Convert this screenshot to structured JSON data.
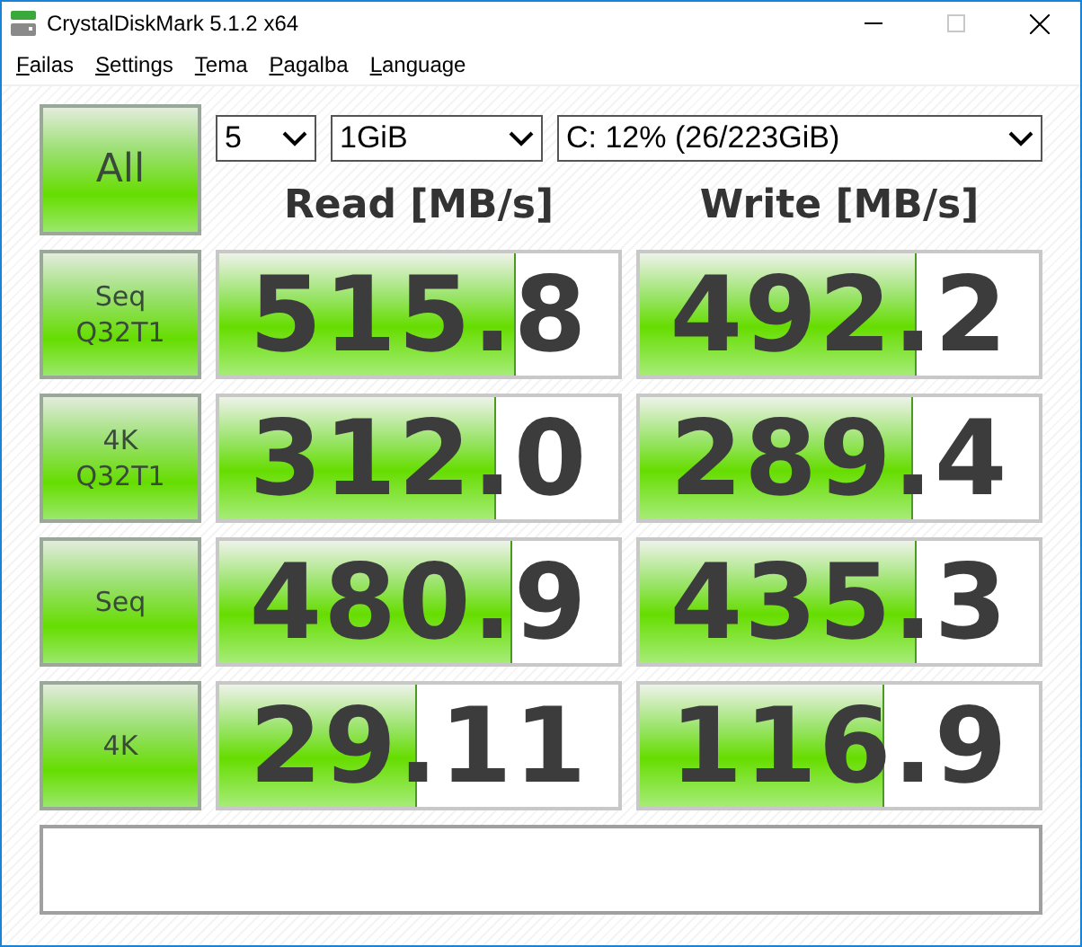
{
  "window": {
    "title": "CrystalDiskMark 5.1.2 x64",
    "maximize_disabled": true
  },
  "menu": [
    {
      "label": "Failas"
    },
    {
      "label": "Settings"
    },
    {
      "label": "Tema"
    },
    {
      "label": "Pagalba"
    },
    {
      "label": "Language"
    }
  ],
  "all_button": "All",
  "selects": [
    {
      "kind": "count",
      "value": "5"
    },
    {
      "kind": "size",
      "value": "1GiB"
    },
    {
      "kind": "drive",
      "value": "C: 12% (26/223GiB)"
    }
  ],
  "columns": [
    "Read [MB/s]",
    "Write [MB/s]"
  ],
  "tests": [
    {
      "label": [
        "Seq",
        "Q32T1"
      ],
      "read": {
        "value": "515.8",
        "level": 0.74
      },
      "write": {
        "value": "492.2",
        "level": 0.69
      }
    },
    {
      "label": [
        "4K",
        "Q32T1"
      ],
      "read": {
        "value": "312.0",
        "level": 0.69
      },
      "write": {
        "value": "289.4",
        "level": 0.68
      }
    },
    {
      "label": [
        "Seq"
      ],
      "read": {
        "value": "480.9",
        "level": 0.73
      },
      "write": {
        "value": "435.3",
        "level": 0.69
      }
    },
    {
      "label": [
        "4K"
      ],
      "read": {
        "value": "29.11",
        "level": 0.49
      },
      "write": {
        "value": "116.9",
        "level": 0.61
      }
    }
  ]
}
